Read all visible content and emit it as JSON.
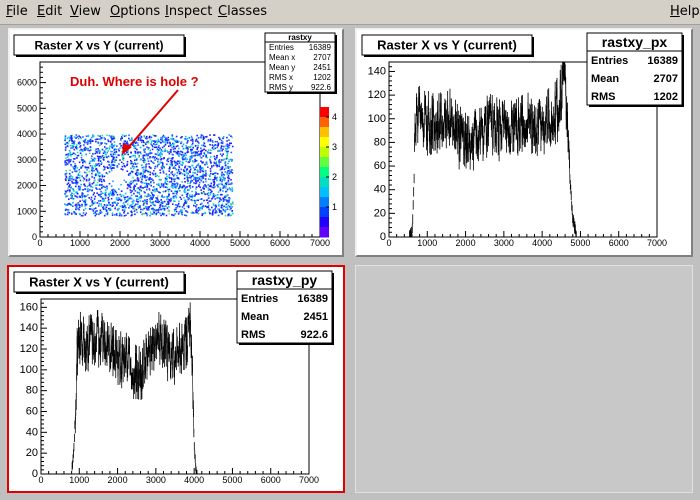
{
  "menu": [
    {
      "label": "File",
      "u": "F",
      "rest": "ile"
    },
    {
      "label": "Edit",
      "u": "E",
      "rest": "dit"
    },
    {
      "label": "View",
      "u": "V",
      "rest": "iew"
    },
    {
      "label": "Options",
      "u": "O",
      "rest": "ptions"
    },
    {
      "label": "Inspect",
      "u": "I",
      "rest": "nspect"
    },
    {
      "label": "Classes",
      "u": "C",
      "rest": "lasses"
    }
  ],
  "help_menu": {
    "label": "Help",
    "u": "H",
    "rest": "elp"
  },
  "pads": {
    "xy": {
      "title": "Raster X vs Y (current)",
      "annotation": "Duh.  Where is hole ?",
      "annotation_color": "#e00000",
      "stats": {
        "name": "rastxy",
        "rows": [
          [
            "Entries",
            "16389"
          ],
          [
            "Mean x",
            "2707"
          ],
          [
            "Mean y",
            "2451"
          ],
          [
            "RMS x",
            "1202"
          ],
          [
            "RMS y",
            "922.6"
          ]
        ]
      },
      "palette_ticks": [
        "1",
        "2",
        "3",
        "4"
      ]
    },
    "px": {
      "title": "Raster X vs Y (current)",
      "stats": {
        "name": "rastxy_px",
        "rows": [
          [
            "Entries",
            "16389"
          ],
          [
            "Mean",
            "2707"
          ],
          [
            "RMS",
            "1202"
          ]
        ]
      }
    },
    "py": {
      "title": "Raster X vs Y (current)",
      "stats": {
        "name": "rastxy_py",
        "rows": [
          [
            "Entries",
            "16389"
          ],
          [
            "Mean",
            "2451"
          ],
          [
            "RMS",
            "922.6"
          ]
        ]
      }
    }
  },
  "chart_data": [
    {
      "type": "scatter",
      "title": "Raster X vs Y (current)",
      "x_ticks": [
        "0",
        "1000",
        "2000",
        "3000",
        "4000",
        "5000",
        "6000",
        "7000"
      ],
      "y_ticks": [
        "0",
        "1000",
        "2000",
        "3000",
        "4000",
        "5000",
        "6000"
      ],
      "xlim": [
        0,
        7000
      ],
      "ylim": [
        0,
        6800
      ],
      "filled_region": {
        "x": [
          600,
          4800
        ],
        "y": [
          850,
          4000
        ]
      },
      "hole": {
        "x": 1900,
        "y": 2300,
        "rx": 300,
        "ry": 400
      }
    },
    {
      "type": "line",
      "title": "Raster X vs Y (current)",
      "x_ticks": [
        "0",
        "1000",
        "2000",
        "3000",
        "4000",
        "5000",
        "6000",
        "7000"
      ],
      "y_ticks": [
        "0",
        "20",
        "40",
        "60",
        "80",
        "100",
        "120",
        "140"
      ],
      "xlim": [
        0,
        7000
      ],
      "ylim": [
        0,
        148
      ],
      "x": [
        500,
        600,
        650,
        700,
        800,
        1000,
        1200,
        1400,
        1600,
        1800,
        2000,
        2200,
        2400,
        2600,
        2800,
        3000,
        3200,
        3400,
        3600,
        3800,
        4000,
        4200,
        4400,
        4500,
        4600,
        4700,
        4800,
        4900
      ],
      "y": [
        0,
        2,
        40,
        105,
        100,
        95,
        100,
        92,
        105,
        85,
        78,
        82,
        88,
        95,
        92,
        90,
        98,
        92,
        100,
        96,
        95,
        100,
        108,
        125,
        140,
        60,
        15,
        0
      ]
    },
    {
      "type": "line",
      "title": "Raster X vs Y (current)",
      "x_ticks": [
        "0",
        "1000",
        "2000",
        "3000",
        "4000",
        "5000",
        "6000",
        "7000"
      ],
      "y_ticks": [
        "0",
        "20",
        "40",
        "60",
        "80",
        "100",
        "120",
        "140",
        "160"
      ],
      "xlim": [
        0,
        7000
      ],
      "ylim": [
        0,
        168
      ],
      "x": [
        800,
        850,
        900,
        950,
        1000,
        1200,
        1400,
        1600,
        1800,
        2000,
        2200,
        2400,
        2600,
        2800,
        3000,
        3200,
        3400,
        3600,
        3800,
        3900,
        3950,
        4000,
        4050,
        4100
      ],
      "y": [
        0,
        20,
        60,
        120,
        130,
        125,
        128,
        132,
        120,
        110,
        110,
        100,
        95,
        112,
        130,
        125,
        110,
        118,
        130,
        145,
        100,
        30,
        2,
        0
      ]
    }
  ]
}
